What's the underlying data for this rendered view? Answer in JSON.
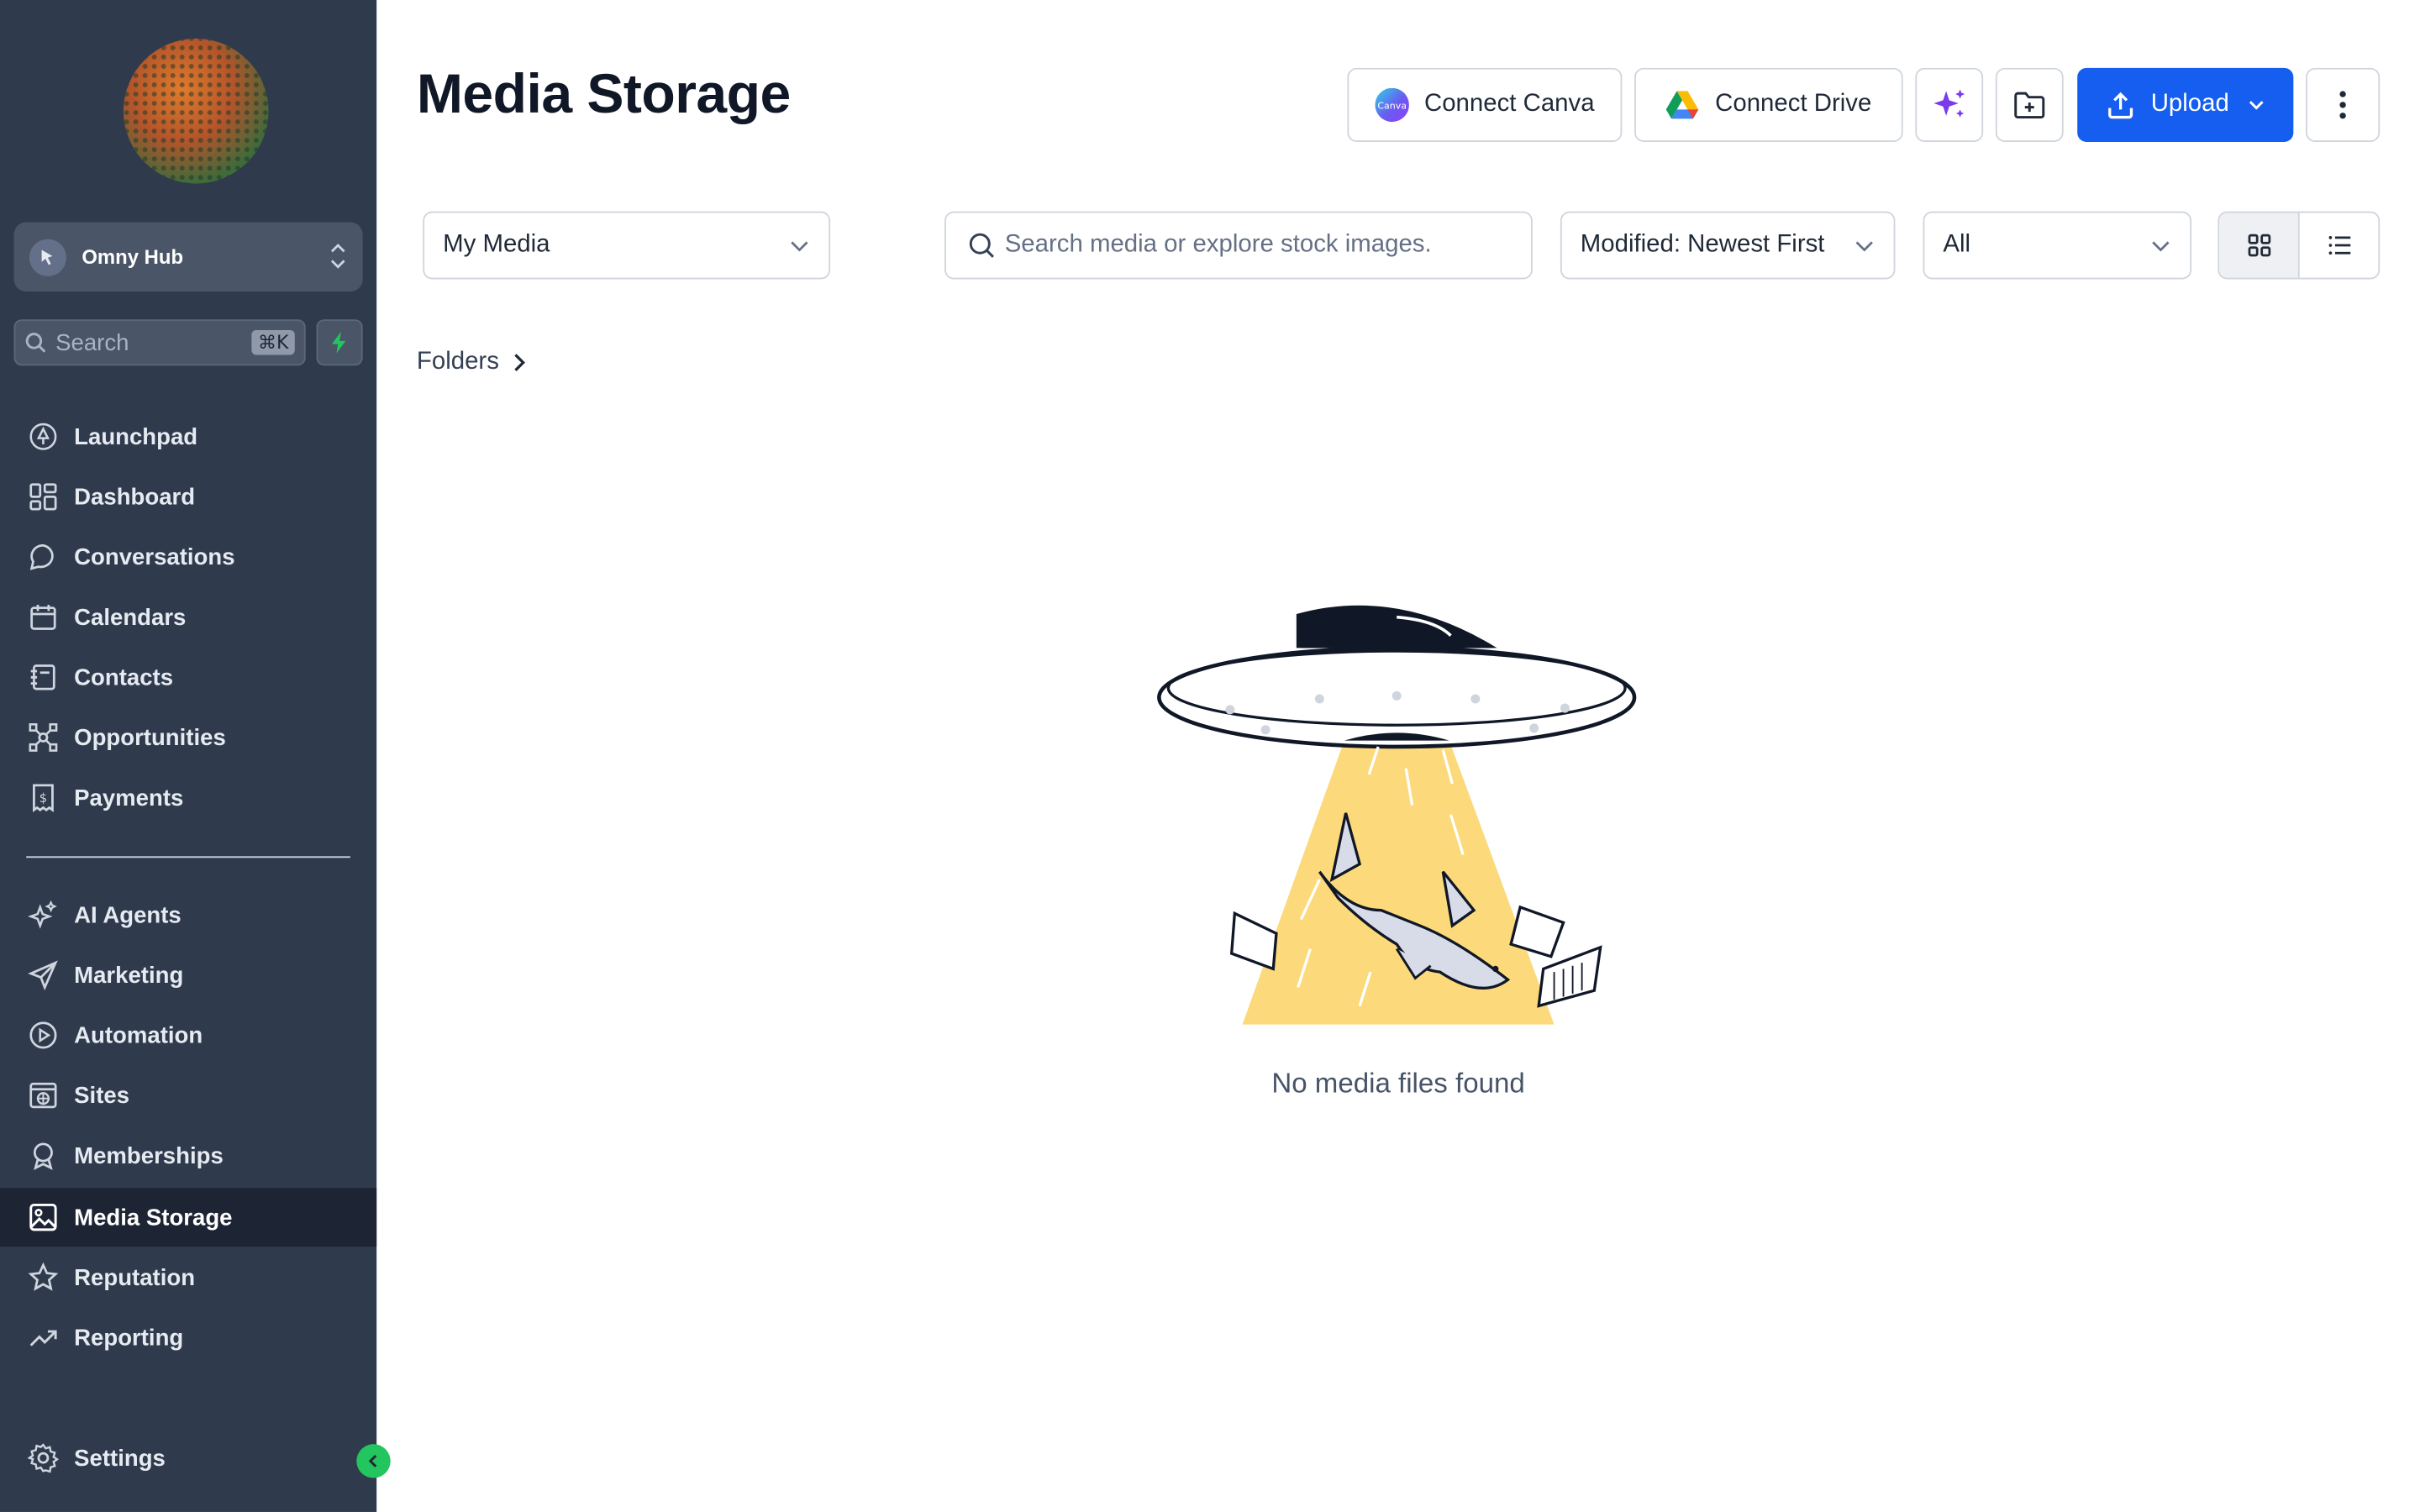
{
  "sidebar": {
    "account_name": "Omny Hub",
    "search_placeholder": "Search",
    "search_shortcut": "⌘K",
    "nav": [
      {
        "label": "Launchpad",
        "icon": "rocket-icon"
      },
      {
        "label": "Dashboard",
        "icon": "dashboard-grid-icon"
      },
      {
        "label": "Conversations",
        "icon": "chat-bubble-icon"
      },
      {
        "label": "Calendars",
        "icon": "calendar-icon"
      },
      {
        "label": "Contacts",
        "icon": "contact-book-icon"
      },
      {
        "label": "Opportunities",
        "icon": "network-icon"
      },
      {
        "label": "Payments",
        "icon": "receipt-dollar-icon"
      },
      {
        "label": "AI Agents",
        "icon": "sparkle-icon"
      },
      {
        "label": "Marketing",
        "icon": "send-icon"
      },
      {
        "label": "Automation",
        "icon": "play-circle-icon"
      },
      {
        "label": "Sites",
        "icon": "globe-window-icon"
      },
      {
        "label": "Memberships",
        "icon": "award-icon"
      },
      {
        "label": "Media Storage",
        "icon": "image-icon",
        "active": true
      },
      {
        "label": "Reputation",
        "icon": "star-icon"
      },
      {
        "label": "Reporting",
        "icon": "trend-up-icon"
      }
    ],
    "settings_label": "Settings",
    "accent": "#22c55e"
  },
  "header": {
    "title": "Media Storage",
    "connect_canva": "Connect Canva",
    "connect_drive": "Connect Drive",
    "upload": "Upload"
  },
  "filters": {
    "source": "My Media",
    "search_placeholder": "Search media or explore stock images.",
    "sort": "Modified: Newest First",
    "type": "All",
    "view": "grid"
  },
  "breadcrumb": {
    "folders": "Folders"
  },
  "empty_state": {
    "message": "No media files found"
  },
  "colors": {
    "sidebar_bg": "#2f3a4d",
    "primary": "#155eef",
    "beam": "#fcd97a"
  }
}
